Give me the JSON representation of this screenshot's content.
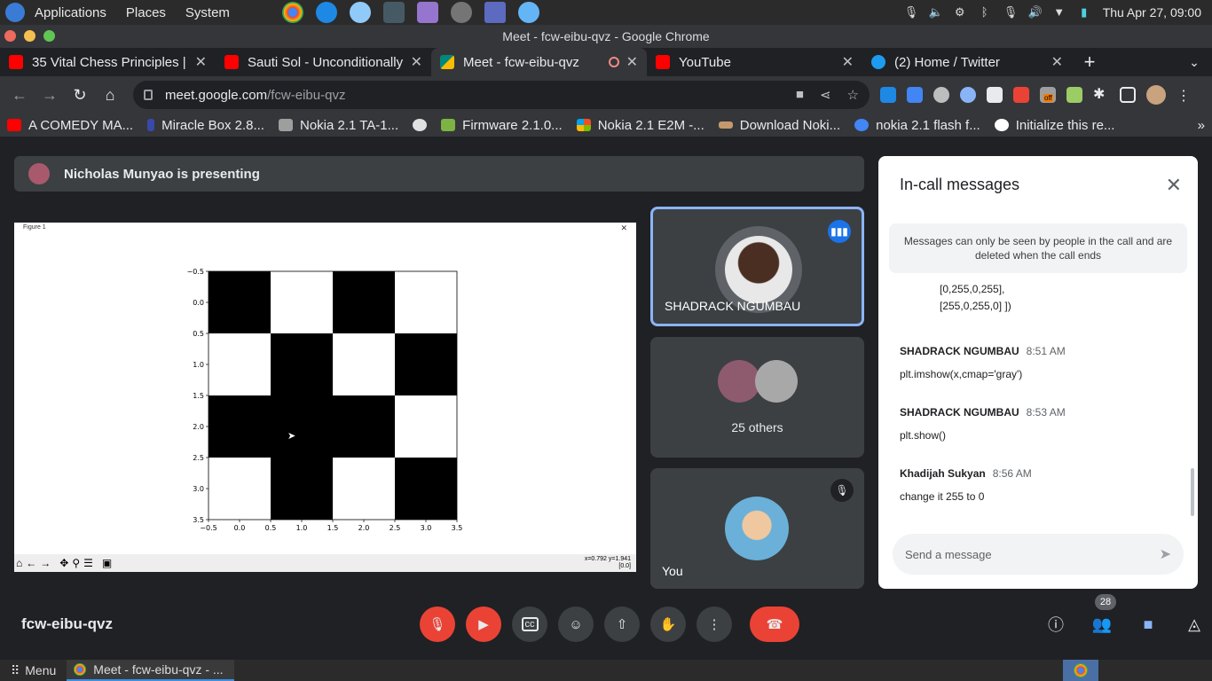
{
  "system": {
    "menus": [
      "Applications",
      "Places",
      "System"
    ],
    "clock": "Thu Apr 27, 09:00"
  },
  "browser": {
    "window_title": "Meet - fcw-eibu-qvz - Google Chrome",
    "tabs": [
      {
        "title": "35 Vital Chess Principles |",
        "favicon_color": "#ff0000"
      },
      {
        "title": "Sauti Sol - Unconditionally",
        "favicon_color": "#ff0000"
      },
      {
        "title": "Meet - fcw-eibu-qvz",
        "favicon_color": "#00897b",
        "active": true
      },
      {
        "title": "YouTube",
        "favicon_color": "#ff0000"
      },
      {
        "title": "(2) Home / Twitter",
        "favicon_color": "#1d9bf0"
      }
    ],
    "url_host": "meet.google.com",
    "url_path": "/fcw-eibu-qvz",
    "extension_badge": "off",
    "bookmarks": [
      {
        "label": "A COMEDY MA...",
        "color": "#ff0000"
      },
      {
        "label": "Miracle Box 2.8...",
        "color": "#3949ab"
      },
      {
        "label": "Nokia 2.1 TA-1...",
        "color": "#9e9e9e"
      },
      {
        "label": "",
        "color": "#e0e0e0"
      },
      {
        "label": "Firmware 2.1.0...",
        "color": "#7cb342"
      },
      {
        "label": "Nokia 2.1 E2M -...",
        "color": "#f25022"
      },
      {
        "label": "Download Noki...",
        "color": "#c49a6c"
      },
      {
        "label": "nokia 2.1 flash f...",
        "color": "#4285f4"
      },
      {
        "label": "Initialize this re...",
        "color": "#ffffff"
      }
    ]
  },
  "meet": {
    "presenting_banner": "Nicholas Munyao is presenting",
    "figure": {
      "window_title": "Figure 1",
      "cursor_readout": "x=0.792 y=1.941",
      "cursor_value": "[0.0]"
    },
    "participants": [
      {
        "name": "SHADRACK NGUMBAU",
        "speaking": true
      },
      {
        "name": "25 others"
      },
      {
        "name": "You",
        "muted": true
      }
    ],
    "meeting_code": "fcw-eibu-qvz",
    "people_count": "28",
    "chat": {
      "title": "In-call messages",
      "notice": "Messages can only be seen by people in the call and are deleted when the call ends",
      "code_lines": [
        "[0,255,0,255],",
        "[255,0,255,0] ])"
      ],
      "messages": [
        {
          "sender": "SHADRACK NGUMBAU",
          "time": "8:51 AM",
          "text": "plt.imshow(x,cmap='gray')"
        },
        {
          "sender": "SHADRACK NGUMBAU",
          "time": "8:53 AM",
          "text": "plt.show()"
        },
        {
          "sender": "Khadijah Sukyan",
          "time": "8:56 AM",
          "text": "change it 255 to 0"
        }
      ],
      "input_placeholder": "Send a message"
    }
  },
  "chart_data": {
    "type": "heatmap",
    "colormap": "gray",
    "matrix": [
      [
        0,
        255,
        0,
        255
      ],
      [
        255,
        0,
        255,
        0
      ],
      [
        0,
        0,
        0,
        255
      ],
      [
        255,
        0,
        255,
        0
      ]
    ],
    "xticks": [
      "−0.5",
      "0.0",
      "0.5",
      "1.0",
      "1.5",
      "2.0",
      "2.5",
      "3.0",
      "3.5"
    ],
    "yticks": [
      "−0.5",
      "0.0",
      "0.5",
      "1.0",
      "1.5",
      "2.0",
      "2.5",
      "3.0",
      "3.5"
    ],
    "xlim": [
      -0.5,
      3.5
    ],
    "ylim": [
      3.5,
      -0.5
    ],
    "title": "",
    "xlabel": "",
    "ylabel": ""
  },
  "taskbar": {
    "menu_label": "Menu",
    "task_label": "Meet - fcw-eibu-qvz - ..."
  }
}
